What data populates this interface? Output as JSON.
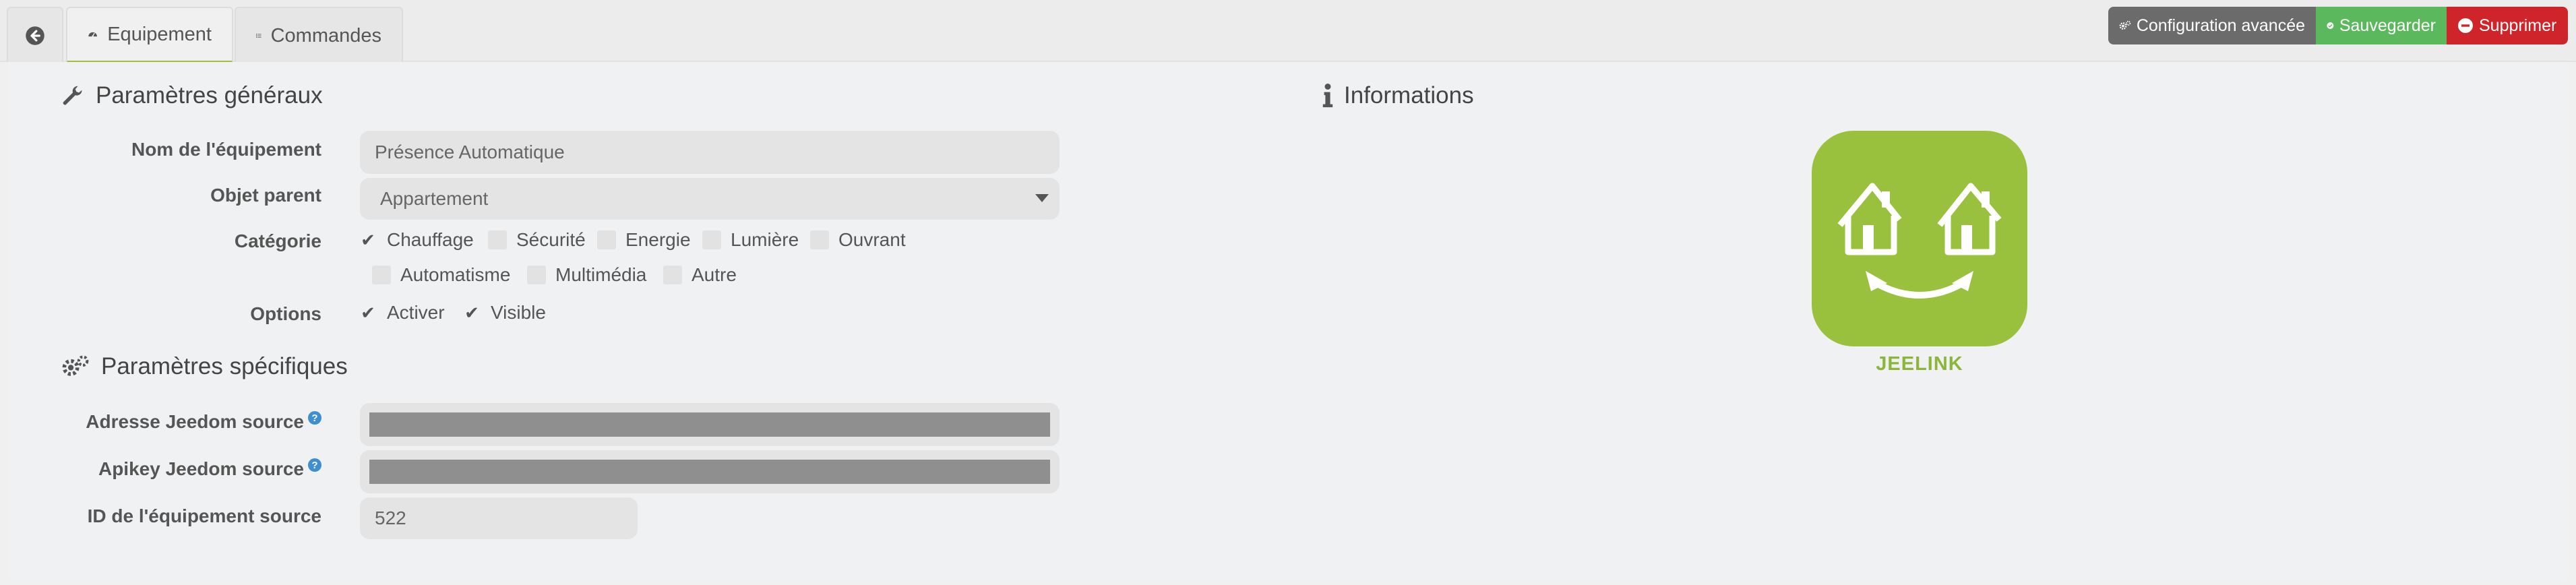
{
  "tabs": [
    {
      "label": "Equipement",
      "icon": "tachometer-icon",
      "active": true
    },
    {
      "label": "Commandes",
      "icon": "list-icon",
      "active": false
    }
  ],
  "actions": {
    "advanced_label": "Configuration avancée",
    "save_label": "Sauvegarder",
    "delete_label": "Supprimer"
  },
  "colors": {
    "accent": "#9dc13b",
    "save": "#5cb85c",
    "delete": "#d0242b",
    "advanced": "#6b6b6b",
    "logo_bg": "#99c13d"
  },
  "general": {
    "title": "Paramètres généraux",
    "name_label": "Nom de l'équipement",
    "name_value": "Présence Automatique",
    "parent_label": "Objet parent",
    "parent_value": "Appartement",
    "category_label": "Catégorie",
    "categories": [
      {
        "label": "Chauffage",
        "checked": true
      },
      {
        "label": "Sécurité",
        "checked": false
      },
      {
        "label": "Energie",
        "checked": false
      },
      {
        "label": "Lumière",
        "checked": false
      },
      {
        "label": "Ouvrant",
        "checked": false
      },
      {
        "label": "Automatisme",
        "checked": false
      },
      {
        "label": "Multimédia",
        "checked": false
      },
      {
        "label": "Autre",
        "checked": false
      }
    ],
    "options_label": "Options",
    "options": [
      {
        "label": "Activer",
        "checked": true
      },
      {
        "label": "Visible",
        "checked": true
      }
    ]
  },
  "specific": {
    "title": "Paramètres spécifiques",
    "address_label": "Adresse Jeedom source",
    "apikey_label": "Apikey Jeedom source",
    "source_id_label": "ID de l'équipement source",
    "source_id_value": "522"
  },
  "info": {
    "title": "Informations",
    "logo_caption": "JEELINK"
  }
}
